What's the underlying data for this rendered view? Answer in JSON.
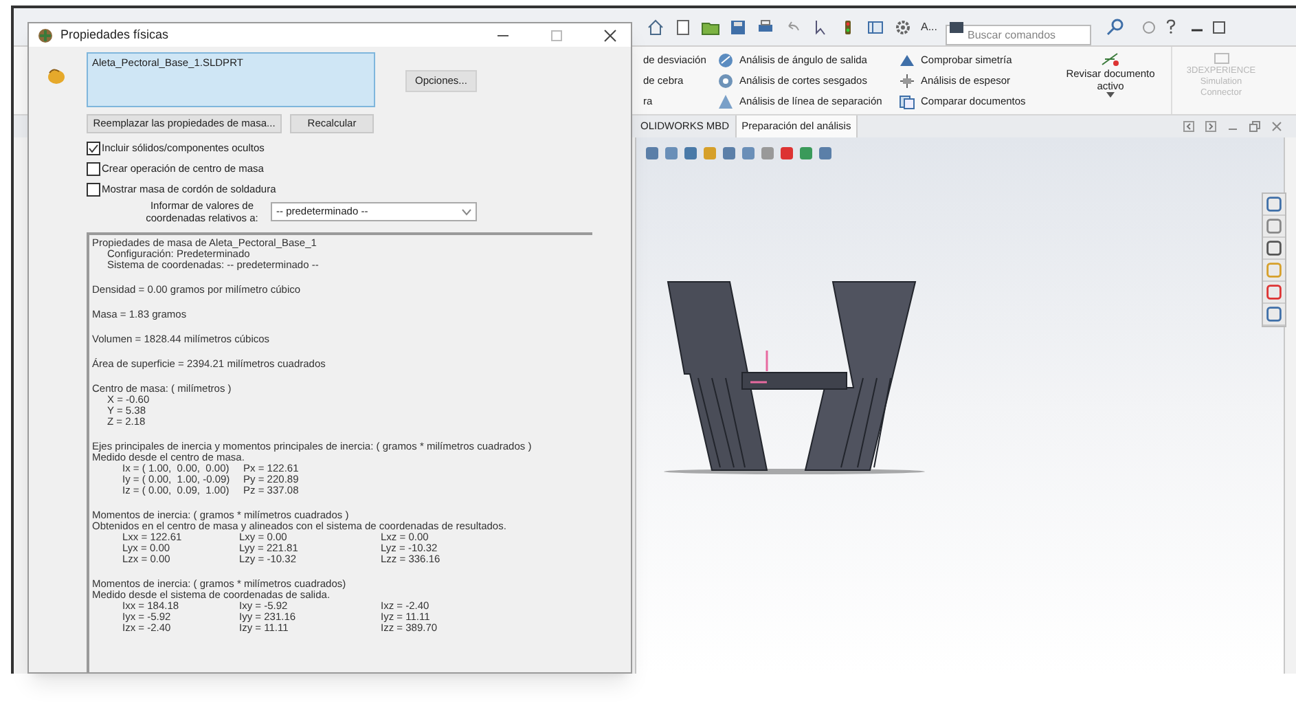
{
  "dialog": {
    "title": "Propiedades físicas",
    "selection": "Aleta_Pectoral_Base_1.SLDPRT",
    "options_button": "Opciones...",
    "buttons": [
      "Reemplazar las propiedades de masa...",
      "Recalcular"
    ],
    "checkboxes": [
      {
        "label": "Incluir sólidos/componentes ocultos",
        "checked": true
      },
      {
        "label": "Crear operación de centro de masa",
        "checked": false
      },
      {
        "label": "Mostrar masa de cordón de soldadura",
        "checked": false
      }
    ],
    "coordinates_label": "Informar de valores de coordenadas relativos a:",
    "coordinates_value": "-- predeterminado --",
    "results": [
      {
        "headings": [
          "Propiedades de masa de Aleta_Pectoral_Base_1"
        ],
        "items": [
          "Configuración: Predeterminado",
          "Sistema de coordenadas: -- predeterminado --"
        ]
      },
      {
        "headings": [
          "Densidad = 0.00 gramos por milímetro cúbico"
        ]
      },
      {
        "headings": [
          "Masa = 1.83 gramos"
        ]
      },
      {
        "headings": [
          "Volumen = 1828.44 milímetros cúbicos"
        ]
      },
      {
        "headings": [
          "Área de superficie = 2394.21  milímetros cuadrados"
        ]
      },
      {
        "headings": [
          "Centro de masa: ( milímetros )"
        ],
        "items": [
          "X = -0.60",
          "Y = 5.38",
          "Z = 2.18"
        ]
      },
      {
        "headings": [
          "Ejes principales de inercia y momentos principales de inercia: ( gramos *  milímetros cuadrados )",
          "Medido desde el centro de masa."
        ],
        "rows": [
          [
            "Ix = ( 1.00,  0.00,  0.00)",
            "Px = 122.61"
          ],
          [
            "Iy = ( 0.00,  1.00, -0.09)",
            "Py = 220.89"
          ],
          [
            "Iz = ( 0.00,  0.09,  1.00)",
            "Pz = 337.08"
          ]
        ]
      },
      {
        "headings": [
          "Momentos de inercia: ( gramos *  milímetros cuadrados )",
          "Obtenidos en el centro de masa y alineados con el sistema de coordenadas de resultados."
        ],
        "rows": [
          [
            "Lxx = 122.61",
            "Lxy = 0.00",
            "Lxz = 0.00"
          ],
          [
            "Lyx = 0.00",
            "Lyy = 221.81",
            "Lyz = -10.32"
          ],
          [
            "Lzx = 0.00",
            "Lzy = -10.32",
            "Lzz = 336.16"
          ]
        ]
      },
      {
        "headings": [
          "Momentos de inercia: ( gramos *  milímetros cuadrados)",
          "Medido desde el sistema de coordenadas de salida."
        ],
        "rows": [
          [
            "Ixx = 184.18",
            "Ixy = -5.92",
            "Ixz = -2.40"
          ],
          [
            "Iyx = -5.92",
            "Iyy = 231.16",
            "Iyz = 11.11"
          ],
          [
            "Izx = -2.40",
            "Izy = 11.11",
            "Izz = 389.70"
          ]
        ]
      }
    ]
  },
  "app": {
    "quick_access_text": "A...",
    "search_placeholder": "Buscar comandos",
    "ribbon_partial": [
      "de desviación",
      "de cebra",
      "ra"
    ],
    "ribbon_tools": [
      [
        "Análisis de ángulo de salida",
        "Análisis de cortes sesgados",
        "Análisis de línea de separación"
      ],
      [
        "Comprobar simetría",
        "Análisis de espesor",
        "Comparar documentos"
      ]
    ],
    "review_button": "Revisar documento activo",
    "disabled_button": {
      "label": "3DEXPERIENCE Simulation Connector",
      "disabled": true
    },
    "tabs": [
      {
        "label": "OLIDWORKS MBD",
        "selected": false
      },
      {
        "label": "Preparación del análisis",
        "selected": true
      }
    ]
  }
}
